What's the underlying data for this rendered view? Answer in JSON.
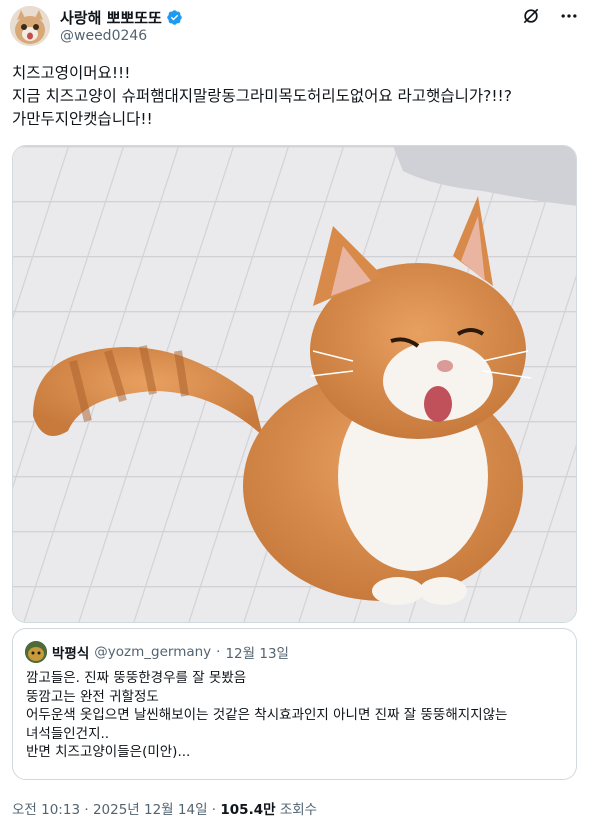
{
  "author": {
    "display_name": "사랑해 뽀뽀또또",
    "handle": "@weed0246",
    "verified_icon": "verified-badge-icon"
  },
  "top_icons": [
    "grok-icon",
    "more-icon"
  ],
  "tweet": {
    "lines": [
      "치즈고영이머요!!!",
      "지금 치즈고양이 슈퍼햄대지말랑동그라미목도허리도없어요 라고햇습니가?!!?",
      "가만두지안캣습니다!!"
    ],
    "image_alt": "치즈고양이"
  },
  "quote": {
    "name": "박평식",
    "handle": "@yozm_germany",
    "separator": "·",
    "date": "12월 13일",
    "lines": [
      "깜고들은. 진짜 뚱뚱한경우를 잘 못봤음",
      "뚱깜고는 완전 귀할정도",
      "어두운색 옷입으면 날씬해보이는 것같은 착시효과인지 아니면 진짜 잘 뚱뚱해지지않는",
      "녀석들인건지..",
      "반면 치즈고양이들은(미안)..."
    ]
  },
  "meta": {
    "time": "오전 10:13",
    "sep1": "·",
    "date": "2025년 12월 14일",
    "sep2": "·",
    "views_count": "105.4만",
    "views_label": "조회수"
  },
  "colors": {
    "text": "#0f1419",
    "secondary": "#536471",
    "border": "#cfd9de",
    "verified": "#1d9bf0"
  }
}
